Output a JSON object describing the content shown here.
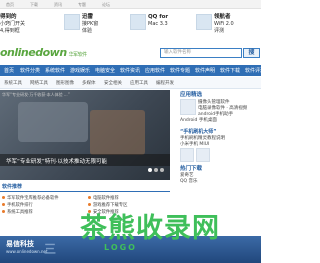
{
  "topbar": {
    "items": [
      "首页",
      "下载",
      "资讯",
      "专题",
      "论坛"
    ]
  },
  "ads": [
    {
      "title": "得到的",
      "sub": "小窍门开关"
    },
    {
      "title": "迅雷",
      "sub": "接PK窗"
    },
    {
      "title": "QQ for",
      "sub": "Mac 3.3"
    },
    {
      "title": "领航者",
      "sub": "WiFi 2.0"
    }
  ],
  "ads_extra": {
    "a0b": "4,得到框",
    "a1b": "体验",
    "a2b": "评测"
  },
  "logo": {
    "text": "onlinedown",
    "cn": "华军软件"
  },
  "search": {
    "placeholder": "输入软件名称",
    "button": "搜"
  },
  "nav": [
    "首页",
    "软件分类",
    "系统软件",
    "游戏娱乐",
    "电脑安全",
    "软件资讯",
    "应用软件",
    "软件专题",
    "软件声明",
    "软件下载",
    "软件评测"
  ],
  "subnav": [
    "系统工具",
    "网络工具",
    "图形图像",
    "多媒体",
    "安全相关",
    "应用工具",
    "编程开发"
  ],
  "banner": {
    "top_text": "华军“专业研发·万千收获·本人体验 ...”",
    "caption": "华军“专业研发”特刊·以技术推动无限可能",
    "dots": [
      true,
      false,
      false
    ]
  },
  "side": {
    "title1": "应用精选",
    "lines1": [
      "摄像头管理软件",
      "电脑录像软件 · 高清视频",
      "android手机助手",
      "Android 手机桌面"
    ],
    "title2": "“手机刷机大师”",
    "lines2": [
      "手机刷机精灵教程说明",
      "小米手机 MIUI"
    ],
    "title3": "热门下载",
    "lines3": [
      "爱奇艺",
      "QQ 音乐"
    ]
  },
  "list": {
    "header": "软件推荐",
    "items": [
      "华军软件宝库推荐必备软件",
      "电脑软件推荐",
      "手机软件排行",
      "游戏推荐下载专区",
      "系统工具推荐",
      "安全软件推荐"
    ]
  },
  "footer": {
    "brand": "易信科技",
    "sub": "www.onlinedown.net",
    "cut": "三"
  },
  "watermark": {
    "main": "茶熊收录网",
    "sub": "LOGO"
  }
}
